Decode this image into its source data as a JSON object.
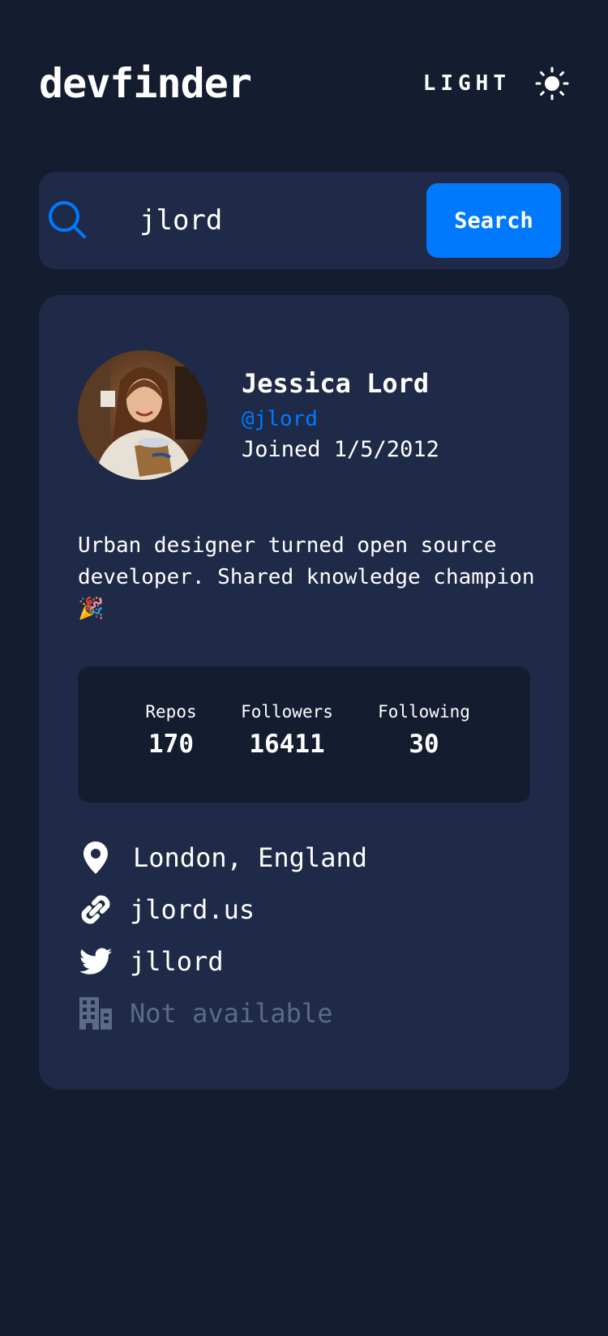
{
  "app": {
    "title": "devfinder"
  },
  "theme_toggle": {
    "label": "LIGHT",
    "icon": "sun-icon"
  },
  "search": {
    "value": "jlord",
    "placeholder": "Search GitHub username…",
    "button_label": "Search",
    "icon": "search-icon"
  },
  "profile": {
    "name": "Jessica Lord",
    "handle": "@jlord",
    "joined": "Joined 1/5/2012",
    "bio": "Urban designer turned open source developer. Shared knowledge champion 🎉",
    "avatar_icon": "user-avatar"
  },
  "stats": [
    {
      "label": "Repos",
      "value": "170"
    },
    {
      "label": "Followers",
      "value": "16411"
    },
    {
      "label": "Following",
      "value": "30"
    }
  ],
  "links": {
    "location": {
      "text": "London, England",
      "icon": "location-pin-icon"
    },
    "blog": {
      "text": "jlord.us",
      "icon": "link-icon"
    },
    "twitter": {
      "text": "jllord",
      "icon": "twitter-icon"
    },
    "company": {
      "text": "Not available",
      "icon": "building-icon"
    }
  },
  "colors": {
    "background": "#141c2f",
    "card": "#1e2a47",
    "accent": "#0079ff",
    "text": "#ffffff",
    "muted": "#5c6a89"
  }
}
